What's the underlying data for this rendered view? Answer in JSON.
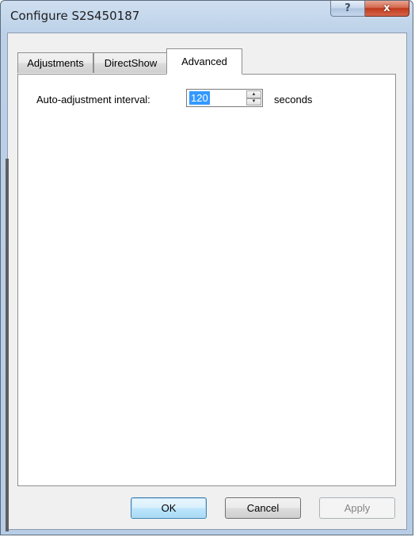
{
  "window": {
    "title": "Configure S2S450187",
    "help_glyph": "?",
    "close_glyph": "x"
  },
  "tabs": [
    {
      "label": "Adjustments",
      "active": false
    },
    {
      "label": "DirectShow",
      "active": false
    },
    {
      "label": "Advanced",
      "active": true
    }
  ],
  "advanced": {
    "interval_label": "Auto-adjustment interval:",
    "interval_value": "120",
    "interval_units": "seconds"
  },
  "buttons": {
    "ok": "OK",
    "cancel": "Cancel",
    "apply": "Apply"
  },
  "colors": {
    "selection": "#3399ff",
    "close_button": "#c0391c"
  }
}
